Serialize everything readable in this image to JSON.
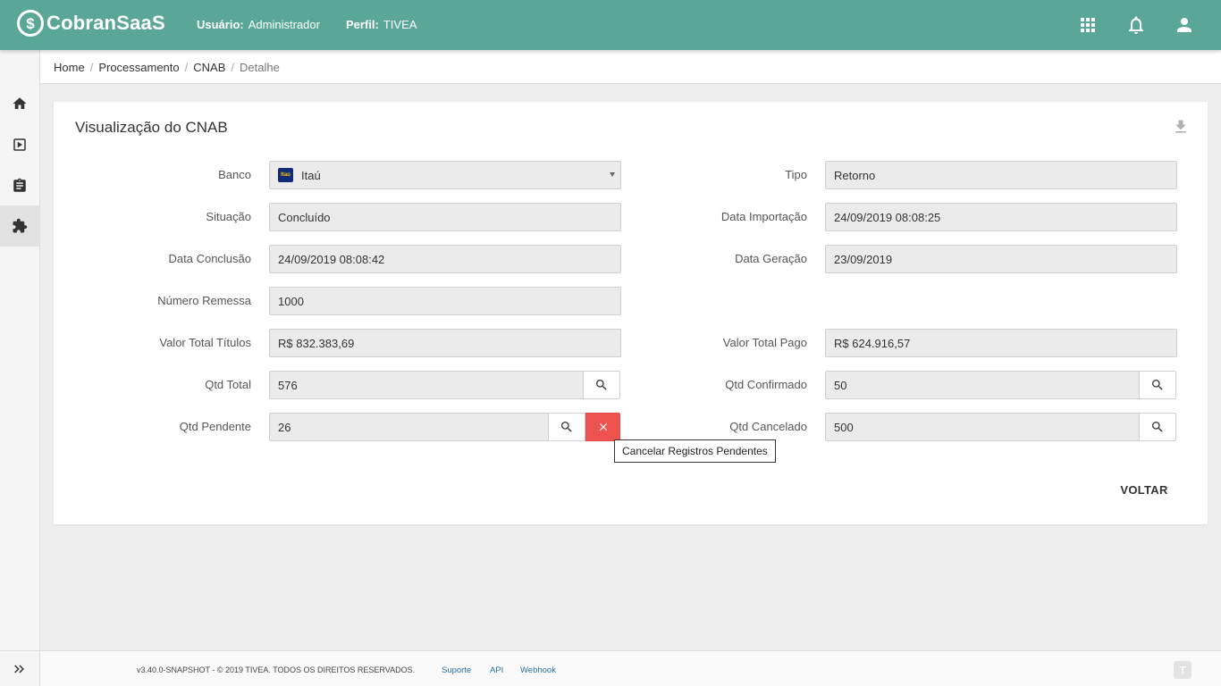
{
  "header": {
    "logo_text": "CobranSaaS",
    "logo_mark": "$",
    "user_label": "Usuário:",
    "user_value": "Administrador",
    "perfil_label": "Perfil:",
    "perfil_value": "TIVEA",
    "icons": [
      "apps-grid-icon",
      "bell-icon",
      "user-icon"
    ],
    "background_color": "#5aa797"
  },
  "sidebar": {
    "items": [
      "home-icon",
      "play-box-icon",
      "clipboard-icon",
      "puzzle-icon"
    ],
    "active_item": "puzzle-icon",
    "toggle_icon": "double-chevron-right-icon"
  },
  "breadcrumb": [
    "Home",
    "Processamento",
    "CNAB",
    "Detalhe"
  ],
  "card": {
    "title": "Visualização do CNAB",
    "download_icon": "download-icon",
    "fields": {
      "banco": {
        "label": "Banco",
        "value": "Itaú",
        "logo_text": "Itaú"
      },
      "tipo": {
        "label": "Tipo",
        "value": "Retorno"
      },
      "situacao": {
        "label": "Situação",
        "value": "Concluído"
      },
      "data_importacao": {
        "label": "Data Importação",
        "value": "24/09/2019 08:08:25"
      },
      "data_conclusao": {
        "label": "Data Conclusão",
        "value": "24/09/2019 08:08:42"
      },
      "data_geracao": {
        "label": "Data Geração",
        "value": "23/09/2019"
      },
      "numero_remessa": {
        "label": "Número Remessa",
        "value": "1000"
      },
      "valor_total_titulos": {
        "label": "Valor Total Títulos",
        "value": "R$ 832.383,69"
      },
      "valor_total_pago": {
        "label": "Valor Total Pago",
        "value": "R$ 624.916,57"
      },
      "qtd_total": {
        "label": "Qtd Total",
        "value": "576"
      },
      "qtd_confirmado": {
        "label": "Qtd Confirmado",
        "value": "50"
      },
      "qtd_pendente": {
        "label": "Qtd Pendente",
        "value": "26"
      },
      "qtd_cancelado": {
        "label": "Qtd Cancelado",
        "value": "500"
      }
    },
    "tooltip": "Cancelar Registros Pendentes",
    "voltar_label": "VOLTAR",
    "cancel_button_color": "#ef5350"
  },
  "footer": {
    "copyright": "v3.40.0-SNAPSHOT - © 2019 TIVEA. TODOS OS DIREITOS RESERVADOS.",
    "links": [
      "Suporte",
      "API",
      "Webhook"
    ],
    "badge_text": "T"
  }
}
